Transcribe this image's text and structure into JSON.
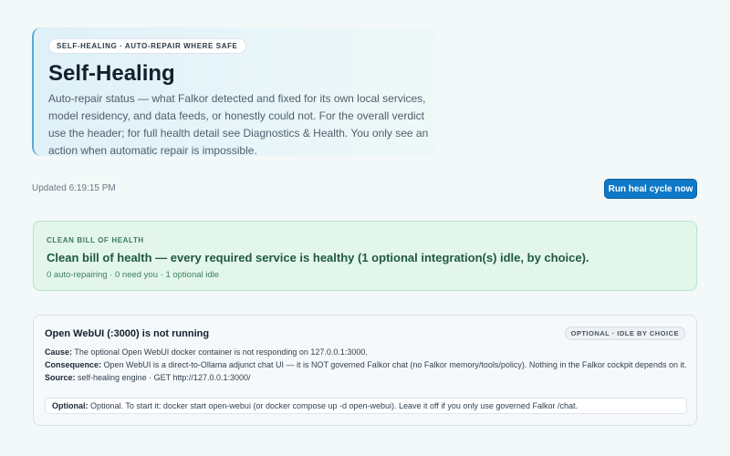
{
  "hero": {
    "eyebrow": "SELF-HEALING · AUTO-REPAIR WHERE SAFE",
    "title": "Self-Healing",
    "description": "Auto-repair status — what Falkor detected and fixed for its own local services, model residency, and data feeds, or honestly could not. For the overall verdict use the header; for full health detail see Diagnostics & Health. You only see an action when automatic repair is impossible."
  },
  "toolbar": {
    "updated": "Updated 6:19:15 PM",
    "run_label": "Run heal cycle now"
  },
  "summary": {
    "eyebrow": "CLEAN BILL OF HEALTH",
    "title": "Clean bill of health — every required service is healthy (1 optional integration(s) idle, by choice).",
    "counts": "0 auto-repairing · 0 need you · 1 optional idle"
  },
  "issue": {
    "title": "Open WebUI (:3000) is not running",
    "badge": "OPTIONAL · IDLE BY CHOICE",
    "cause_label": "Cause:",
    "cause": "The optional Open WebUI docker container is not responding on 127.0.0.1:3000.",
    "consequence_label": "Consequence:",
    "consequence": "Open WebUI is a direct-to-Ollama adjunct chat UI — it is NOT governed Falkor chat (no Falkor memory/tools/policy). Nothing in the Falkor cockpit depends on it.",
    "source_label": "Source:",
    "source": "self-healing engine · GET http://127.0.0.1:3000/",
    "optional_label": "Optional:",
    "optional": "Optional. To start it: docker start open-webui (or docker compose up -d open-webui). Leave it off if you only use governed Falkor /chat."
  },
  "colors": {
    "accent": "#0e78c9",
    "healthy_bg": "#e3f6ec",
    "healthy_text": "#1f5a3d"
  }
}
